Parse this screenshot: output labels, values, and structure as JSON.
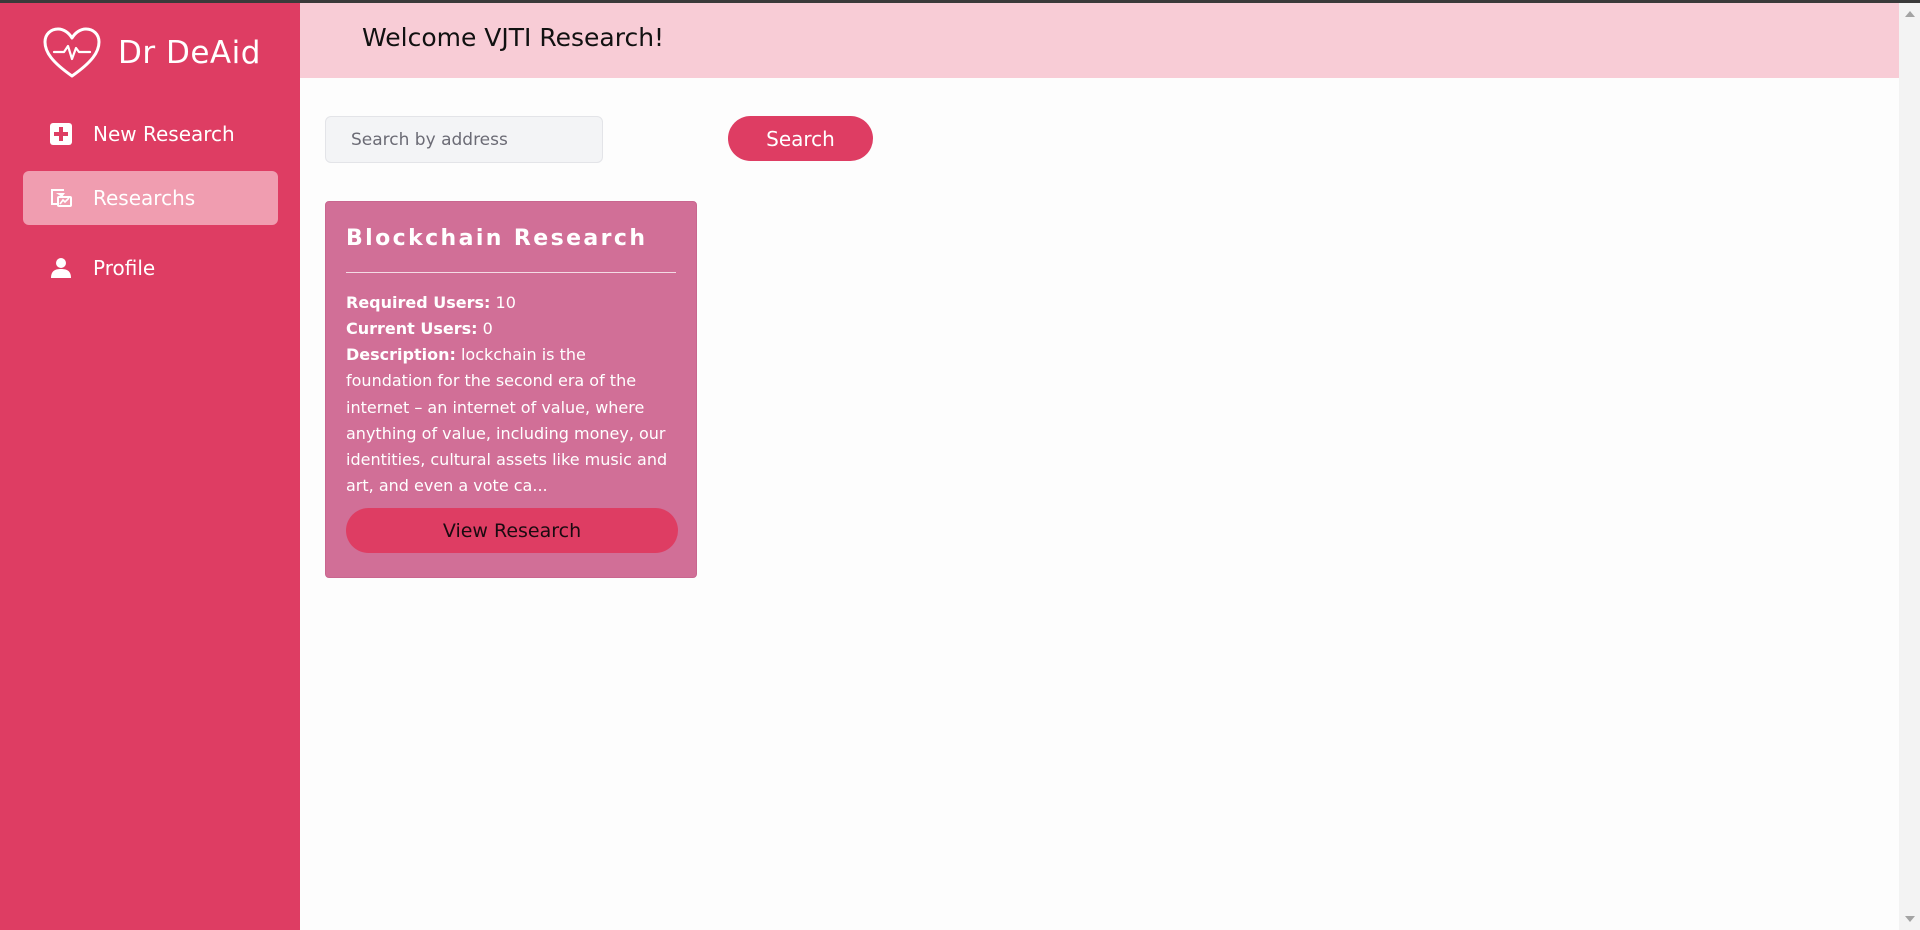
{
  "brand": {
    "name": "Dr DeAid",
    "logo_icon": "heart-pulse-icon",
    "color": "#de3d63"
  },
  "sidebar": {
    "items": [
      {
        "label": "New Research",
        "icon": "plus-square-icon",
        "active": false
      },
      {
        "label": "Researchs",
        "icon": "research-icon",
        "active": true
      },
      {
        "label": "Profile",
        "icon": "user-icon",
        "active": false
      }
    ]
  },
  "header": {
    "title": "Welcome VJTI Research!"
  },
  "search": {
    "placeholder": "Search by address",
    "value": "",
    "button_label": "Search"
  },
  "researches": [
    {
      "title": "Blockchain Research",
      "required_users_label": "Required Users:",
      "required_users": "10",
      "current_users_label": "Current Users:",
      "current_users": "0",
      "description_label": "Description:",
      "description": "lockchain is the foundation for the second era of the internet – an internet of value, where anything of value, including money, our identities, cultural assets like music and art, and even a vote ca...",
      "button_label": "View Research"
    }
  ],
  "colors": {
    "sidebar": "#de3d63",
    "sidebar_active": "#f09db0",
    "header": "#f8ccd6",
    "card": "#d16f97",
    "button": "#de3d63"
  }
}
